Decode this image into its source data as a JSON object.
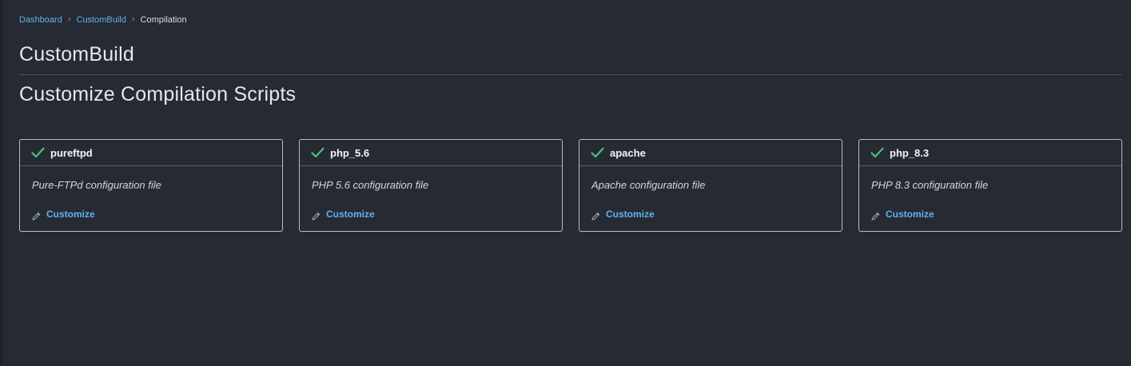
{
  "breadcrumb": {
    "items": [
      {
        "label": "Dashboard"
      },
      {
        "label": "CustomBuild"
      }
    ],
    "current": "Compilation",
    "separator": "›"
  },
  "page": {
    "title": "CustomBuild",
    "section_title": "Customize Compilation Scripts"
  },
  "cards": [
    {
      "name": "pureftpd",
      "description": "Pure-FTPd configuration file",
      "action": "Customize",
      "status_icon": "check-icon"
    },
    {
      "name": "php_5.6",
      "description": "PHP 5.6 configuration file",
      "action": "Customize",
      "status_icon": "check-icon"
    },
    {
      "name": "apache",
      "description": "Apache configuration file",
      "action": "Customize",
      "status_icon": "check-icon"
    },
    {
      "name": "php_8.3",
      "description": "PHP 8.3 configuration file",
      "action": "Customize",
      "status_icon": "check-icon"
    }
  ],
  "colors": {
    "background": "#262a33",
    "link": "#5fb4ea",
    "check": "#4fbf7a",
    "border": "#b9bdc3"
  }
}
